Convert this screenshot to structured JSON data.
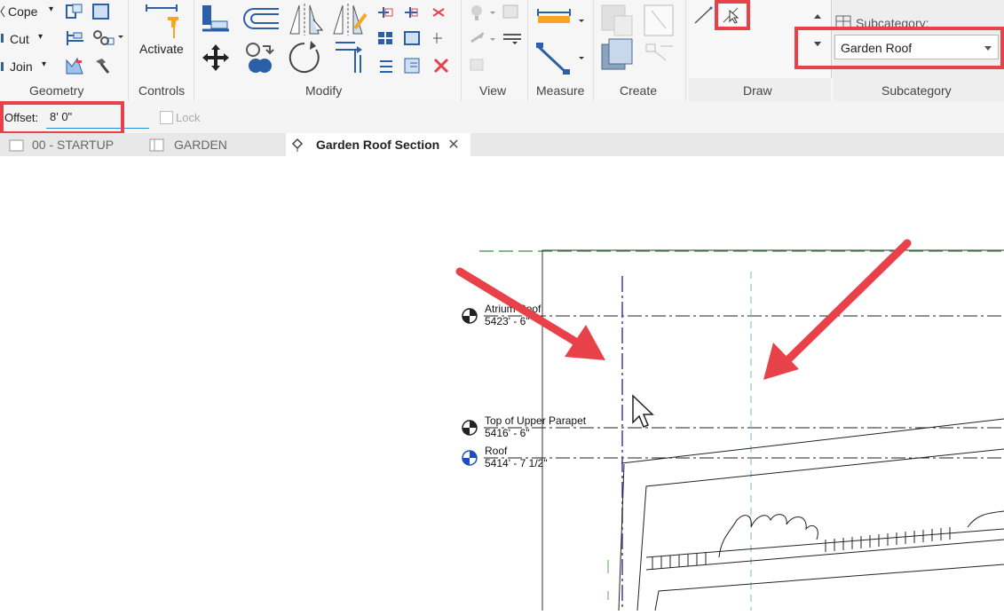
{
  "ribbon": {
    "geometry": {
      "label": "Geometry",
      "cope": "Cope",
      "cut": "Cut",
      "join": "Join"
    },
    "controls": {
      "label": "Controls",
      "activate": "Activate"
    },
    "modify": {
      "label": "Modify"
    },
    "view": {
      "label": "View"
    },
    "measure": {
      "label": "Measure"
    },
    "create": {
      "label": "Create"
    },
    "draw": {
      "label": "Draw"
    },
    "subcategory": {
      "label": "Subcategory",
      "header": "Subcategory:",
      "value": "Garden Roof"
    }
  },
  "options_bar": {
    "offset_label": "Offset:",
    "offset_value": "8'  0\"",
    "lock_label": "Lock"
  },
  "tabs": [
    {
      "label": "00 - STARTUP"
    },
    {
      "label": "GARDEN"
    },
    {
      "label": "Garden Roof Section"
    }
  ],
  "levels": [
    {
      "name": "Atrium Roof",
      "elevation": "5423' - 6\""
    },
    {
      "name": "Top of Upper Parapet",
      "elevation": "5416' - 6\""
    },
    {
      "name": "Roof",
      "elevation": "5414' - 7 1/2\""
    }
  ],
  "colors": {
    "highlight": "#e8414a",
    "arrow": "#e8414a",
    "level_blue": "#1f4fbf"
  }
}
